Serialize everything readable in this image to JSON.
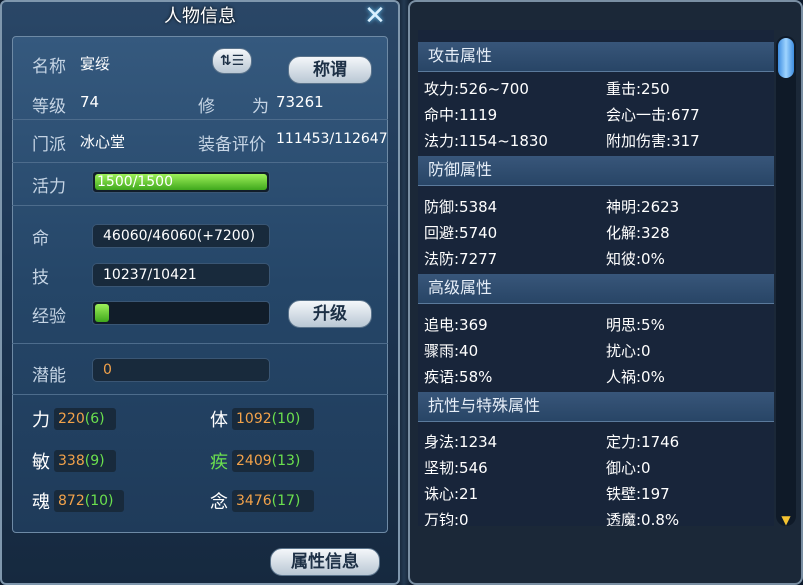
{
  "left": {
    "title": "人物信息",
    "name_label": "名称",
    "name_value": "宴绥",
    "title_button": "称谓",
    "level_label": "等级",
    "level_value": "74",
    "cultivation_label_a": "修",
    "cultivation_label_b": "为",
    "cultivation_value": "73261",
    "sect_label": "门派",
    "sect_value": "冰心堂",
    "gear_label": "装备评价",
    "gear_value": "111453/112647",
    "vitality_label": "活力",
    "vitality_value": "1500/1500",
    "vitality_fill": 1.0,
    "hp_label": "命",
    "hp_value": "46060/46060(+7200)",
    "mp_label": "技",
    "mp_value": "10237/10421",
    "exp_label": "经验",
    "exp_fill": 0.1,
    "upgrade_button": "升级",
    "potential_label": "潜能",
    "potential_value": "0",
    "attrs": [
      {
        "label": "力",
        "value": "220",
        "bonus": "(6)"
      },
      {
        "label": "体",
        "value": "1092",
        "bonus": "(10)"
      },
      {
        "label": "敏",
        "value": "338",
        "bonus": "(9)"
      },
      {
        "label": "疾",
        "value": "2409",
        "bonus": "(13)"
      },
      {
        "label": "魂",
        "value": "872",
        "bonus": "(10)"
      },
      {
        "label": "念",
        "value": "3476",
        "bonus": "(17)"
      }
    ],
    "attr_info_button": "属性信息"
  },
  "right": {
    "sections": [
      {
        "title": "攻击属性",
        "rows": [
          "攻力:526~700",
          "重击:250",
          "命中:1119",
          "会心一击:677",
          "法力:1154~1830",
          "附加伤害:317"
        ]
      },
      {
        "title": "防御属性",
        "rows": [
          "防御:5384",
          "神明:2623",
          "回避:5740",
          "化解:328",
          "法防:7277",
          "知彼:0%"
        ]
      },
      {
        "title": "高级属性",
        "rows": [
          "追电:369",
          "明思:5%",
          "骤雨:40",
          "扰心:0",
          "疾语:58%",
          "人祸:0%"
        ]
      },
      {
        "title": "抗性与特殊属性",
        "rows": [
          "身法:1234",
          "定力:1746",
          "坚韧:546",
          "御心:0",
          "诛心:21",
          "铁壁:197",
          "万钧:0",
          "透魔:0.8%"
        ]
      }
    ]
  },
  "colors": {
    "bonus_green": "#6be04e",
    "value_orange": "#f2a24a",
    "bar_green": "#4fb624",
    "scroll_arrow": "#f4c331"
  }
}
